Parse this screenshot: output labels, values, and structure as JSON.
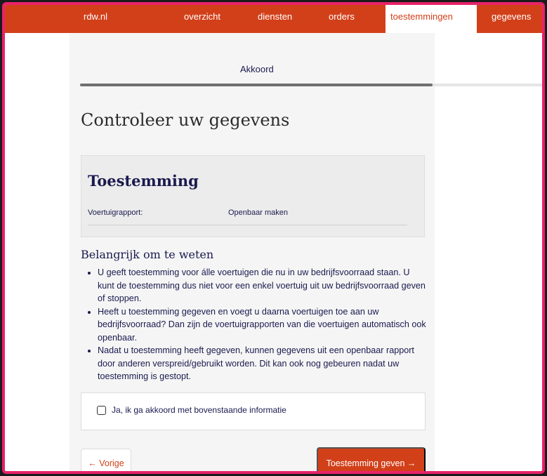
{
  "nav": {
    "brand": "rdw.nl",
    "items": [
      {
        "label": "overzicht"
      },
      {
        "label": "diensten"
      },
      {
        "label": "orders"
      },
      {
        "label": "toestemmingen"
      },
      {
        "label": "gegevens"
      }
    ],
    "active": "toestemmingen"
  },
  "step": {
    "label": "Akkoord",
    "progress": 0.76
  },
  "page_title": "Controleer uw gegevens",
  "card": {
    "title": "Toestemming",
    "row": {
      "key": "Voertuigrapport:",
      "value": "Openbaar maken"
    }
  },
  "info": {
    "title": "Belangrijk om te weten",
    "bullets": [
      "U geeft toestemming voor álle voertuigen die nu in uw bedrijfsvoorraad staan. U kunt de toestemming dus niet voor een enkel voertuig uit uw bedrijfsvoorraad geven of stoppen.",
      "Heeft u toestemming gegeven en voegt u daarna voertuigen toe aan uw bedrijfsvoorraad? Dan zijn de voertuigrapporten van die voertuigen automatisch ook openbaar.",
      "Nadat u toestemming heeft gegeven, kunnen gegevens uit een openbaar rapport door anderen verspreid/gebruikt worden. Dit kan ook nog gebeuren nadat uw toestemming is gestopt."
    ]
  },
  "consent": {
    "label": "Ja, ik ga akkoord met bovenstaande informatie",
    "checked": false
  },
  "buttons": {
    "back": "← Vorige",
    "next": "Toestemming geven →"
  },
  "colors": {
    "brand_orange": "#d2401a",
    "navy_text": "#1a1a4f",
    "frame_border": "#e8226a"
  }
}
